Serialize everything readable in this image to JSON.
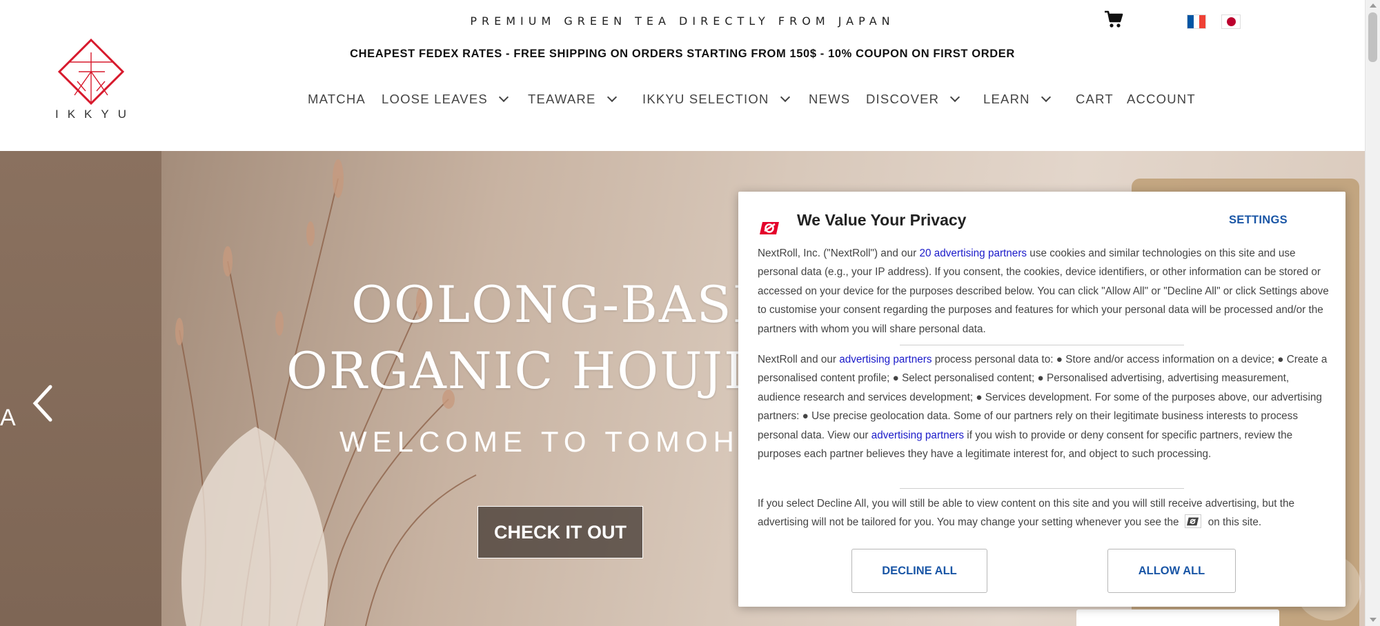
{
  "header": {
    "tagline": "PREMIUM GREEN TEA DIRECTLY FROM JAPAN",
    "promo": "CHEAPEST FEDEX RATES - FREE SHIPPING ON ORDERS STARTING FROM 150$ - 10% COUPON ON FIRST ORDER",
    "logo_text": "IKKYU",
    "cart_icon": "shopping-cart-icon",
    "languages": [
      {
        "name": "french-flag-icon",
        "colors": [
          "#0055a4",
          "#ffffff",
          "#ef4135"
        ]
      },
      {
        "name": "japanese-flag-icon",
        "colors": [
          "#ffffff",
          "#bc002d"
        ]
      }
    ]
  },
  "nav": {
    "items": [
      {
        "label": "MATCHA",
        "dropdown": false
      },
      {
        "label": "LOOSE LEAVES",
        "dropdown": true
      },
      {
        "label": "TEAWARE",
        "dropdown": true
      },
      {
        "label": "IKKYU SELECTION",
        "dropdown": true
      },
      {
        "label": "NEWS",
        "dropdown": false
      },
      {
        "label": "DISCOVER",
        "dropdown": true
      },
      {
        "label": "LEARN",
        "dropdown": true
      },
      {
        "label": "CART",
        "dropdown": false
      },
      {
        "label": "ACCOUNT",
        "dropdown": false
      }
    ]
  },
  "hero": {
    "title_line1": "OOLONG-BASED",
    "title_line2": "ORGANIC HOUJICHA",
    "subtitle": "WELCOME TO TOMOHANA",
    "cta": "CHECK IT OUT",
    "partial_letter": "A",
    "prev_icon": "chevron-left-icon"
  },
  "privacy": {
    "title": "We Value Your Privacy",
    "settings_label": "SETTINGS",
    "p1_before": "NextRoll, Inc. (\"NextRoll\") and our ",
    "p1_link": "20 advertising partners",
    "p1_after": " use cookies and similar technologies on this site and use personal data (e.g., your IP address). If you consent, the cookies, device identifiers, or other information can be stored or accessed on your device for the purposes described below. You can click \"Allow All\" or \"Decline All\" or click Settings above to customise your consent regarding the purposes and features for which your personal data will be processed and/or the partners with whom you will share personal data.",
    "p2_before": "NextRoll and our ",
    "p2_link1": "advertising partners",
    "p2_middle": " process personal data to: ● Store and/or access information on a device; ● Create a personalised content profile; ● Select personalised content; ● Personalised advertising, advertising measurement, audience research and services development; ● Services development. For some of the purposes above, our advertising partners: ● Use precise geolocation data. Some of our partners rely on their legitimate business interests to process personal data. View our ",
    "p2_link2": "advertising partners",
    "p2_after": " if you wish to provide or deny consent for specific partners, review the purposes each partner believes they have a legitimate interest for, and object to such processing.",
    "p3_before": "If you select Decline All, you will still be able to view content on this site and you will still receive advertising, but the advertising will not be tailored for you. You may change your setting whenever you see the ",
    "p3_after": "on this site.",
    "decline_label": "DECLINE ALL",
    "allow_label": "ALLOW ALL",
    "accent_color": "#e4002b",
    "button_text_color": "#1a56a6"
  }
}
